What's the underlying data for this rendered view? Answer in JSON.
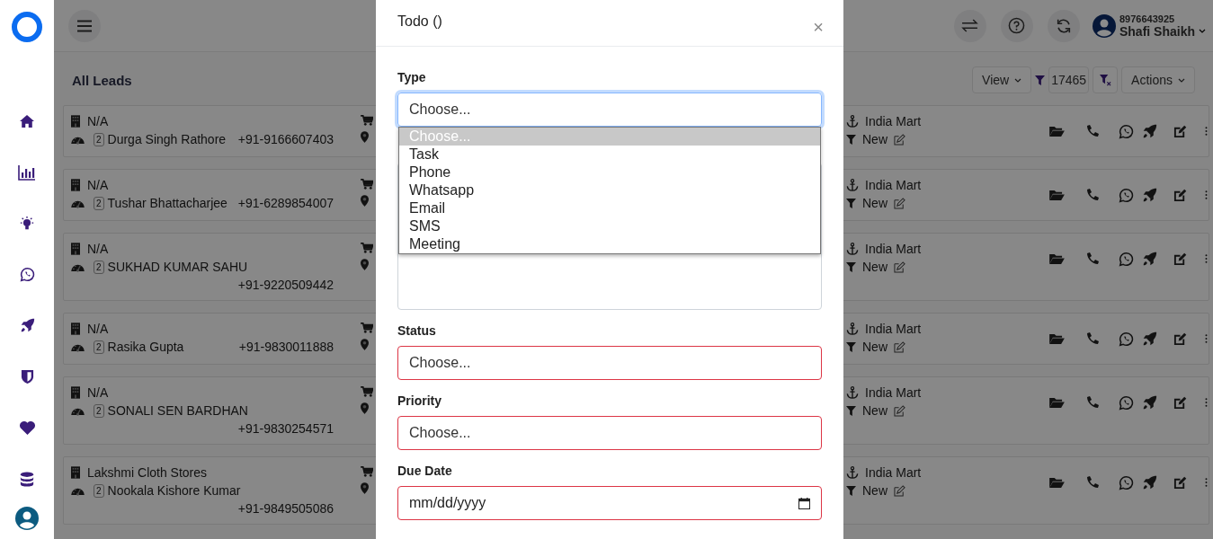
{
  "header": {
    "phone": "8976643925",
    "user": "Shafi Shaikh"
  },
  "page_title": "All Leads",
  "toolbar": {
    "view": "View",
    "filter_count": "17465",
    "actions": "Actions"
  },
  "leads": [
    {
      "company": "N/A",
      "badge": "2",
      "name": "Durga Singh Rathore",
      "phone": "+91-9166607403",
      "source": "India Mart",
      "stage": "New"
    },
    {
      "company": "N/A",
      "badge": "2",
      "name": "Tushar Bhattacharjee",
      "phone": "+91-6289854007",
      "source": "India Mart",
      "stage": "New"
    },
    {
      "company": "N/A",
      "badge": "2",
      "name": "SUKHAD KUMAR SAHU",
      "phone": "+91-9220509442",
      "source": "India Mart",
      "stage": "New"
    },
    {
      "company": "N/A",
      "badge": "2",
      "name": "Rasika Gupta",
      "phone": "+91-9830011888",
      "source": "India Mart",
      "stage": "New"
    },
    {
      "company": "N/A",
      "badge": "2",
      "name": "SONALI SEN BARDHAN",
      "phone": "+91-9830254571",
      "source": "India Mart",
      "stage": "New"
    },
    {
      "company": "Lakshmi Cloth Stores",
      "badge": "2",
      "name": "Nookala Kishore Kumar",
      "phone": "+91-9849505086",
      "source": "India Mart",
      "stage": "New"
    }
  ],
  "modal": {
    "title": "Todo ()",
    "close": "×",
    "fields": [
      {
        "kind": "select",
        "label": "Type",
        "value": "Choose...",
        "focused": true,
        "invalid": false
      },
      {
        "kind": "textarea",
        "focused": false,
        "invalid": false
      },
      {
        "kind": "select",
        "label": "Status",
        "value": "Choose...",
        "focused": false,
        "invalid": true
      },
      {
        "kind": "select",
        "label": "Priority",
        "value": "Choose...",
        "focused": false,
        "invalid": true
      },
      {
        "kind": "date",
        "label": "Due Date",
        "placeholder": "mm/dd/yyyy",
        "focused": false,
        "invalid": true
      }
    ],
    "dropdown": {
      "options": [
        {
          "label": "Choose...",
          "selected": true
        },
        {
          "label": "Task",
          "selected": false
        },
        {
          "label": "Phone",
          "selected": false
        },
        {
          "label": "Whatsapp",
          "selected": false
        },
        {
          "label": "Email",
          "selected": false
        },
        {
          "label": "SMS",
          "selected": false
        },
        {
          "label": "Meeting",
          "selected": false
        }
      ]
    }
  }
}
